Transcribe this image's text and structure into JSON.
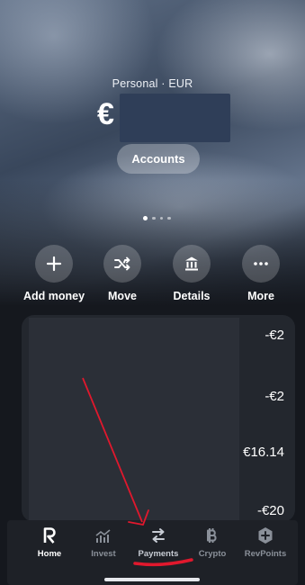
{
  "header": {
    "account_label": "Personal · EUR",
    "currency_sign": "€",
    "accounts_button": "Accounts"
  },
  "pager": {
    "count": 4,
    "active_index": 0
  },
  "actions": [
    {
      "label": "Add money",
      "icon": "plus-icon"
    },
    {
      "label": "Move",
      "icon": "shuffle-icon"
    },
    {
      "label": "Details",
      "icon": "bank-icon"
    },
    {
      "label": "More",
      "icon": "more-icon"
    }
  ],
  "transactions": [
    {
      "amount": "-€2"
    },
    {
      "amount": "-€2"
    },
    {
      "amount": "€16.14"
    },
    {
      "amount": "-€20"
    }
  ],
  "tabbar": {
    "items": [
      {
        "label": "Home",
        "icon": "revolut-r-icon",
        "state": "active"
      },
      {
        "label": "Invest",
        "icon": "chart-icon",
        "state": "inactive"
      },
      {
        "label": "Payments",
        "icon": "transfer-arrows-icon",
        "state": "highlighted"
      },
      {
        "label": "Crypto",
        "icon": "bitcoin-icon",
        "state": "inactive"
      },
      {
        "label": "RevPoints",
        "icon": "revpoints-icon",
        "state": "inactive"
      }
    ]
  },
  "colors": {
    "annotation": "#e0182d",
    "redaction": "#2f3e58",
    "tabbar_bg": "#1e2127"
  }
}
